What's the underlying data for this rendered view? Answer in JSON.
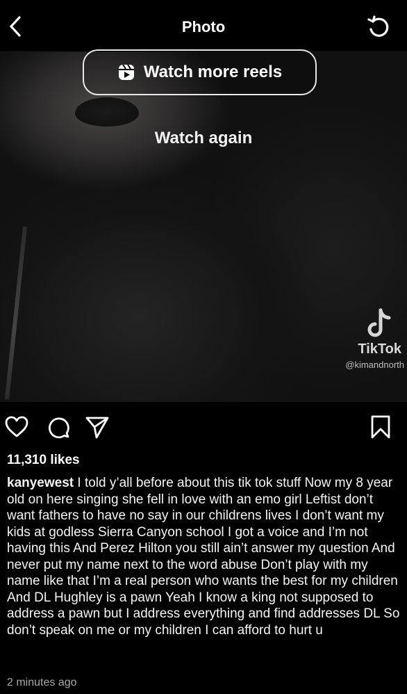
{
  "header": {
    "title": "Photo",
    "back_icon": "chevron-left-icon",
    "replay_icon": "replay-icon"
  },
  "media": {
    "watch_more_reels_label": "Watch more reels",
    "reels_icon": "reels-icon",
    "watch_again_label": "Watch again",
    "watermark": {
      "brand": "TikTok",
      "handle": "@kimandnorth"
    }
  },
  "actions": {
    "like_icon": "heart-icon",
    "comment_icon": "comment-icon",
    "share_icon": "share-icon",
    "save_icon": "bookmark-icon"
  },
  "post": {
    "likes": "11,310 likes",
    "username": "kanyewest",
    "caption": "I told y’all before about this tik tok stuff  Now my 8 year old on here singing she fell in love with an emo girl  Leftist don’t want fathers to have no say in our childrens lives  I don’t want my kids at godless Sierra Canyon school  I got a voice and I’m not having this  And Perez Hilton you still ain’t answer my question  And never put my name next to the word abuse  Don’t play with my name like that  I’m a real person who wants the best for my children  And DL Hughley is a pawn  Yeah I know a king not supposed to address a pawn but I address everything and find addresses DL  So don’t speak on me or my children  I can afford to hurt u",
    "timestamp": "2 minutes ago"
  }
}
